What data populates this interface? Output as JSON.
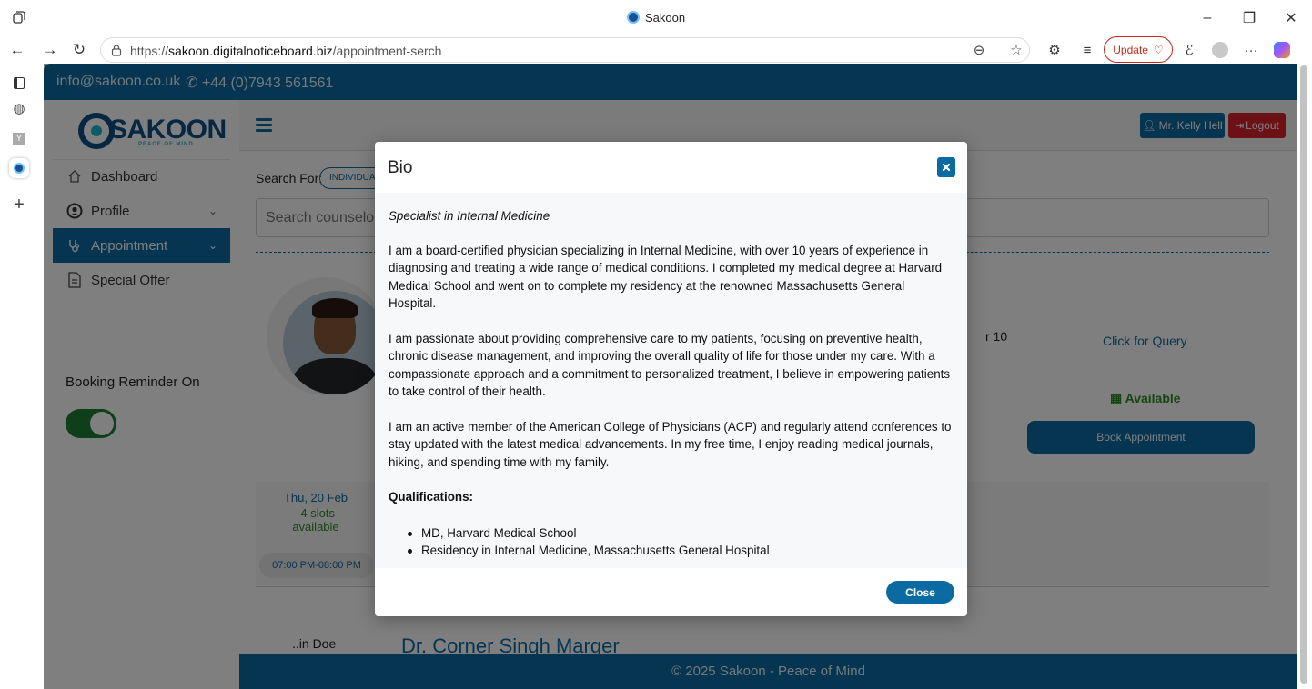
{
  "browser": {
    "title": "Sakoon",
    "url_prefix": "https://",
    "url_host": "sakoon.digitalnoticeboard.biz",
    "url_path": "/appointment-serch",
    "update_label": "Update"
  },
  "topbar": {
    "email": "info@sakoon.co.uk",
    "phone": "+44 (0)7943 561561"
  },
  "logo": {
    "word": "SAKOON",
    "tagline": "PEACE OF MIND"
  },
  "sidebar": {
    "items": [
      {
        "label": "Dashboard"
      },
      {
        "label": "Profile"
      },
      {
        "label": "Appointment"
      },
      {
        "label": "Special Offer"
      }
    ],
    "reminder_label": "Booking Reminder On"
  },
  "header": {
    "user_label": "Mr. Kelly Hell",
    "logout_label": "Logout"
  },
  "search": {
    "label": "Search For:",
    "filter_pill": "INDIVIDUAL",
    "placeholder": "Search counselors"
  },
  "counselor_card": {
    "partial_text": "r 10",
    "query_link": "Click for Query",
    "availability": "Available",
    "book_label": "Book Appointment",
    "slot_date": "Thu, 20 Feb",
    "slot_count": "-4 slots available",
    "slot_time": "07:00 PM-08:00 PM"
  },
  "next_card": {
    "partial_name": "..in Doe",
    "doctor_name": "Dr. Corner Singh Marger"
  },
  "footer": {
    "text": "© 2025 Sakoon - Peace of Mind"
  },
  "modal": {
    "title": "Bio",
    "subtitle": "Specialist in Internal Medicine",
    "paragraphs": [
      "I am a board-certified physician specializing in Internal Medicine, with over 10 years of experience in diagnosing and treating a wide range of medical conditions. I completed my medical degree at Harvard Medical School and went on to complete my residency at the renowned Massachusetts General Hospital.",
      "I am passionate about providing comprehensive care to my patients, focusing on preventive health, chronic disease management, and improving the overall quality of life for those under my care. With a compassionate approach and a commitment to personalized treatment, I believe in empowering patients to take control of their health.",
      "I am an active member of the American College of Physicians (ACP) and regularly attend conferences to stay updated with the latest medical advancements. In my free time, I enjoy reading medical journals, hiking, and spending time with my family."
    ],
    "qualifications_heading": "Qualifications:",
    "qualifications": [
      "MD, Harvard Medical School",
      "Residency in Internal Medicine, Massachusetts General Hospital"
    ],
    "close_label": "Close"
  },
  "colors": {
    "brand_blue": "#0a6aa1",
    "logout_red": "#d9222a",
    "available_green": "#2e8b22",
    "toggle_green": "#1e7e34"
  }
}
